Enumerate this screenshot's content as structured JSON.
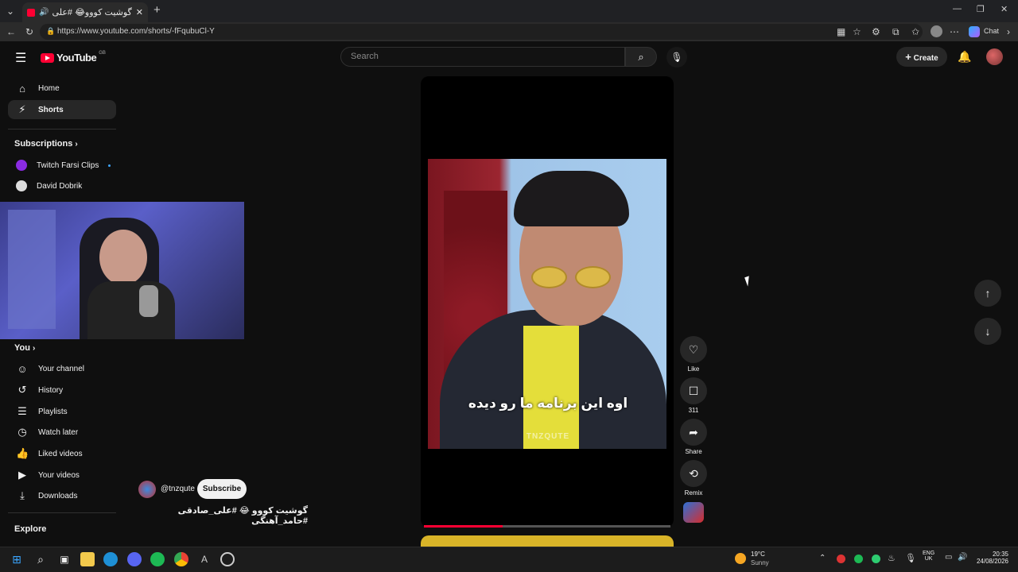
{
  "browser": {
    "tab_title": "گوشیت کووو😂 #علی_صادق",
    "url": "https://www.youtube.com/shorts/-fFqubuCl-Y",
    "chat_label": "Chat"
  },
  "youtube": {
    "logo": "YouTube",
    "region": "GB",
    "search_placeholder": "Search",
    "create_label": "Create",
    "sidebar": {
      "main": [
        {
          "label": "Home",
          "icon": "home-icon"
        },
        {
          "label": "Shorts",
          "icon": "shorts-icon"
        }
      ],
      "subscriptions_title": "Subscriptions",
      "subscriptions": [
        {
          "label": "Twitch Farsi Clips"
        },
        {
          "label": "David Dobrik"
        }
      ],
      "you_title": "You",
      "you": [
        {
          "label": "Your channel",
          "icon": "person-icon"
        },
        {
          "label": "History",
          "icon": "history-icon"
        },
        {
          "label": "Playlists",
          "icon": "playlist-icon"
        },
        {
          "label": "Watch later",
          "icon": "clock-icon"
        },
        {
          "label": "Liked videos",
          "icon": "thumb-up-icon"
        },
        {
          "label": "Your videos",
          "icon": "video-icon"
        },
        {
          "label": "Downloads",
          "icon": "download-icon"
        }
      ],
      "explore_title": "Explore"
    },
    "short": {
      "subtitle": "اوه این برنامه ما رو دیده",
      "watermark": "TNZQUTE",
      "channel": "@tnzqute",
      "subscribe_label": "Subscribe",
      "title": "گوشیت کووو 😂 #علی_صادقی #حامد_آهنگی",
      "progress": 0.32
    },
    "actions": {
      "like": "Like",
      "comments": "311",
      "share": "Share",
      "remix": "Remix"
    }
  },
  "taskbar": {
    "weather_temp": "19°C",
    "weather_desc": "Sunny",
    "lang_1": "ENG",
    "lang_2": "UK",
    "time": "20:35",
    "date": "24/08/2026"
  },
  "colors": {
    "accent_red": "#ff0033",
    "bg": "#0f0f0f"
  }
}
